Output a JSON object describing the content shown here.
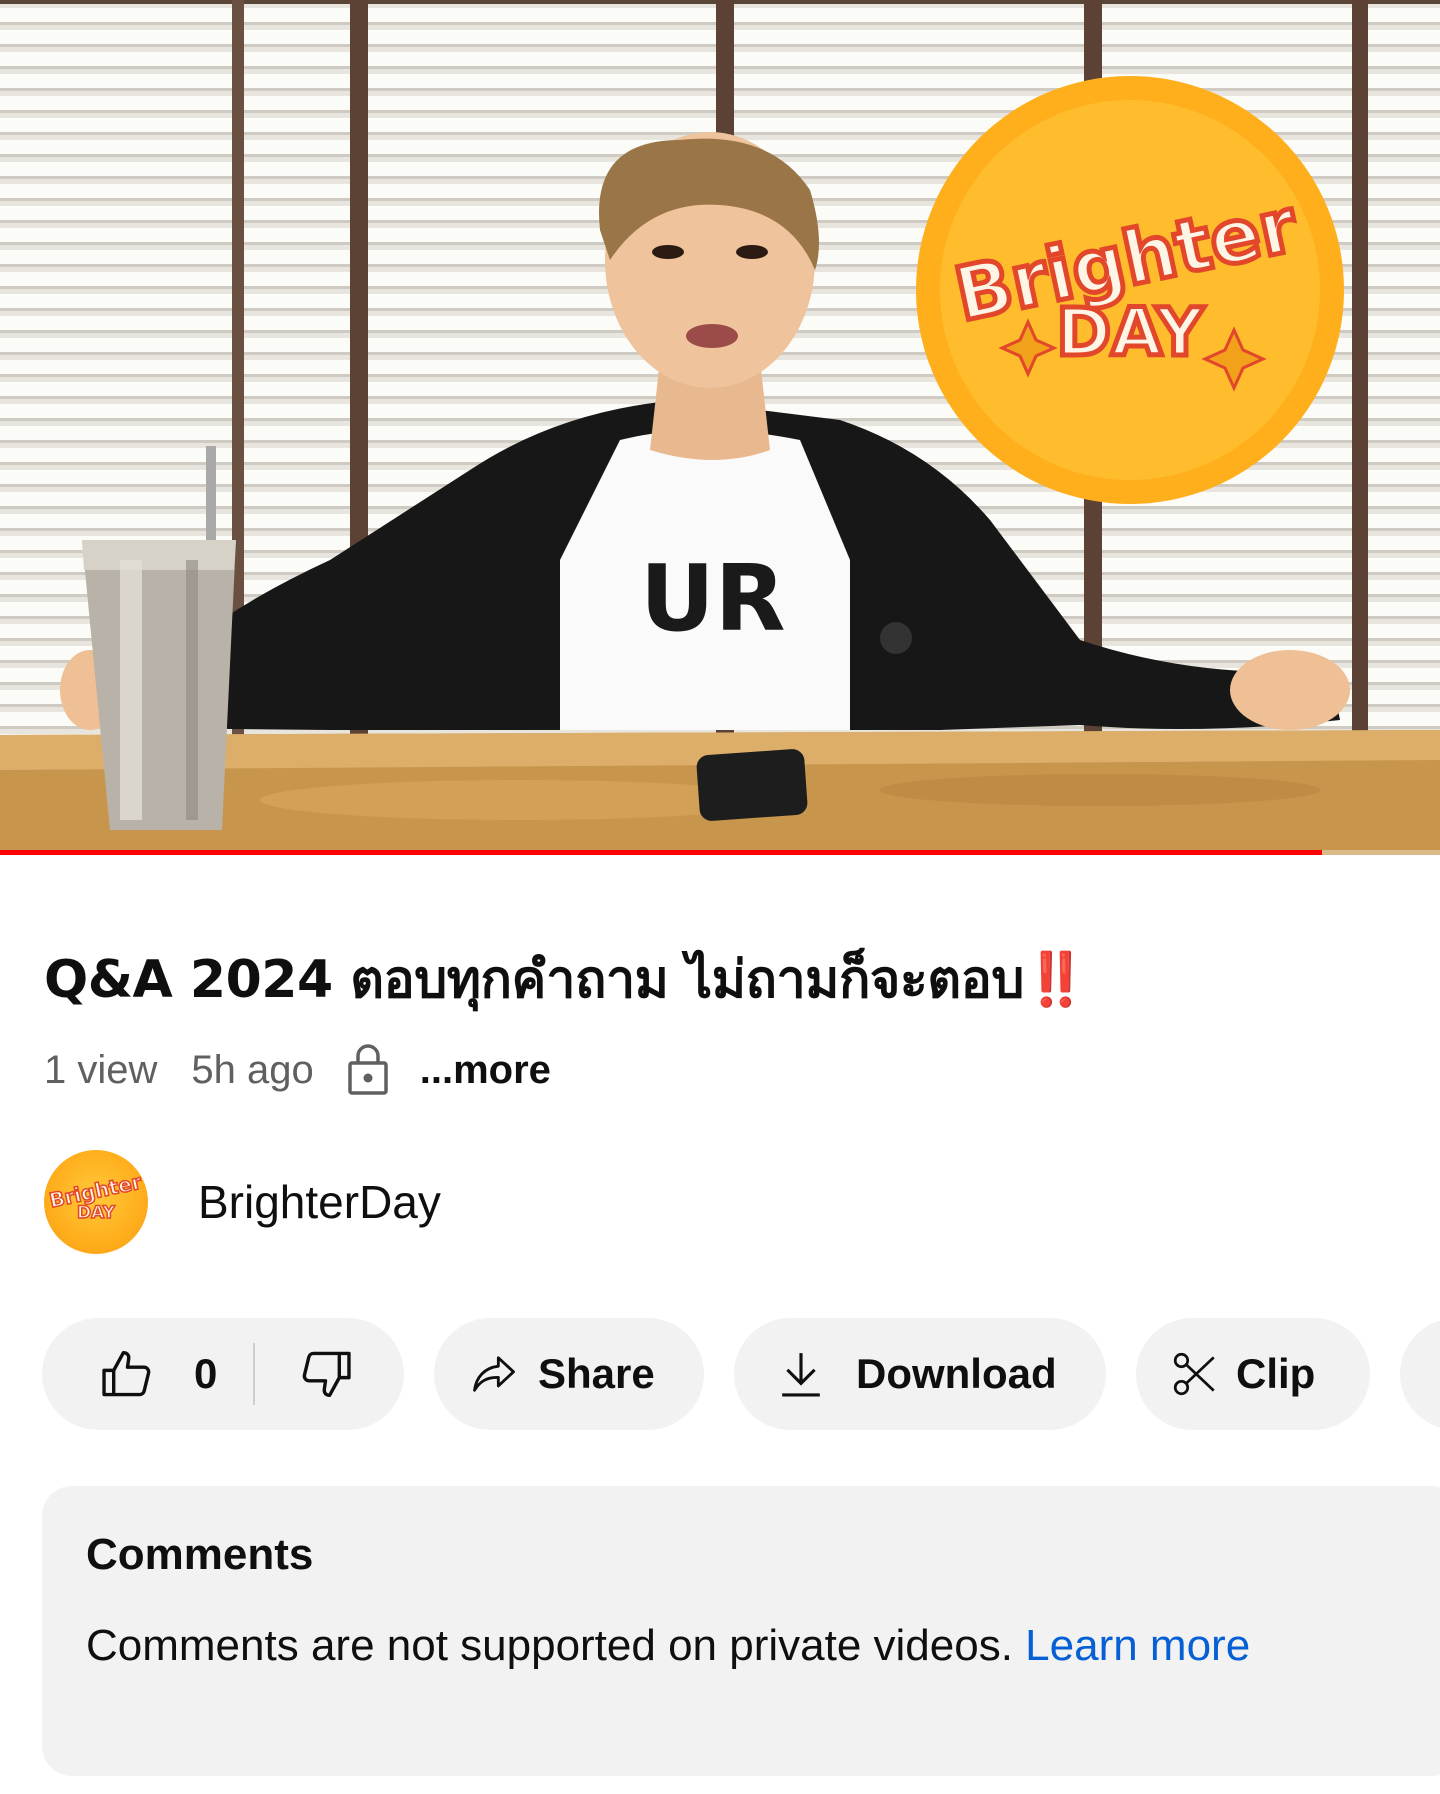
{
  "player": {
    "progress_fraction": 0.918,
    "overlay_logo_line1": "Brighter",
    "overlay_logo_line2": "DAY",
    "shirt_text": "UR"
  },
  "video": {
    "title_main": "Q&A 2024 ตอบทุกคำถาม ไม่ถามก็จะตอบ",
    "title_emoji": "‼️",
    "views": "1 view",
    "age": "5h ago",
    "privacy_icon": "lock-icon",
    "more_label": "...more"
  },
  "channel": {
    "name": "BrighterDay",
    "avatar_line1": "Brighter",
    "avatar_line2": "DAY"
  },
  "actions": {
    "like_count": "0",
    "share_label": "Share",
    "download_label": "Download",
    "clip_label": "Clip"
  },
  "comments": {
    "title": "Comments",
    "message": "Comments are not supported on private videos. ",
    "learn_more_label": "Learn more"
  },
  "colors": {
    "progress": "#ff0000",
    "pill_background": "#f2f2f2",
    "link": "#065fd4",
    "logo_orange": "#ffae1c"
  }
}
